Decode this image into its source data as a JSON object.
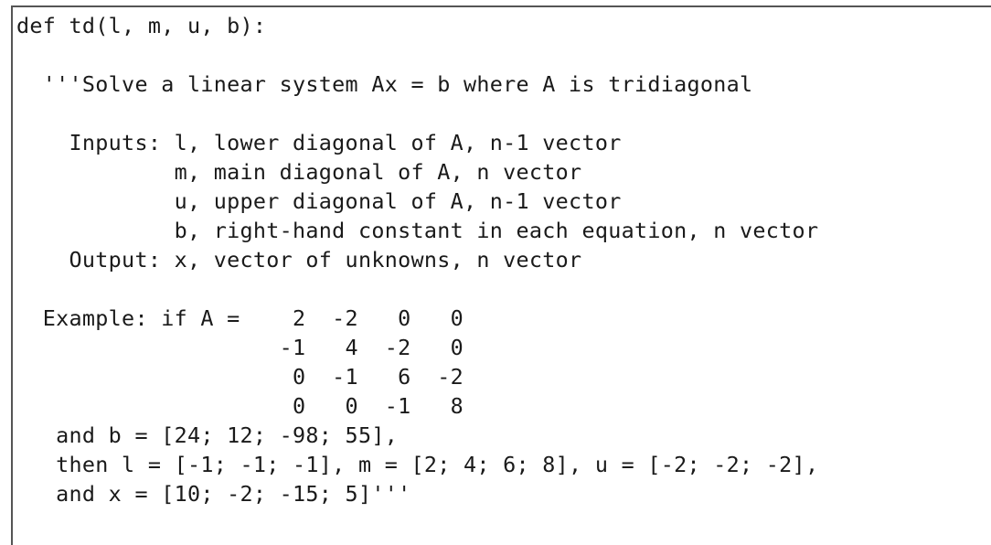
{
  "code": {
    "language": "python",
    "lines": [
      "def td(l, m, u, b):",
      "",
      "  '''Solve a linear system Ax = b where A is tridiagonal",
      "",
      "    Inputs: l, lower diagonal of A, n-1 vector",
      "            m, main diagonal of A, n vector",
      "            u, upper diagonal of A, n-1 vector",
      "            b, right-hand constant in each equation, n vector",
      "    Output: x, vector of unknowns, n vector",
      "",
      "  Example: if A =    2  -2   0   0",
      "                    -1   4  -2   0",
      "                     0  -1   6  -2",
      "                     0   0  -1   8",
      "   and b = [24; 12; -98; 55],",
      "   then l = [-1; -1; -1], m = [2; 4; 6; 8], u = [-2; -2; -2],",
      "   and x = [10; -2; -15; 5]'''"
    ]
  }
}
